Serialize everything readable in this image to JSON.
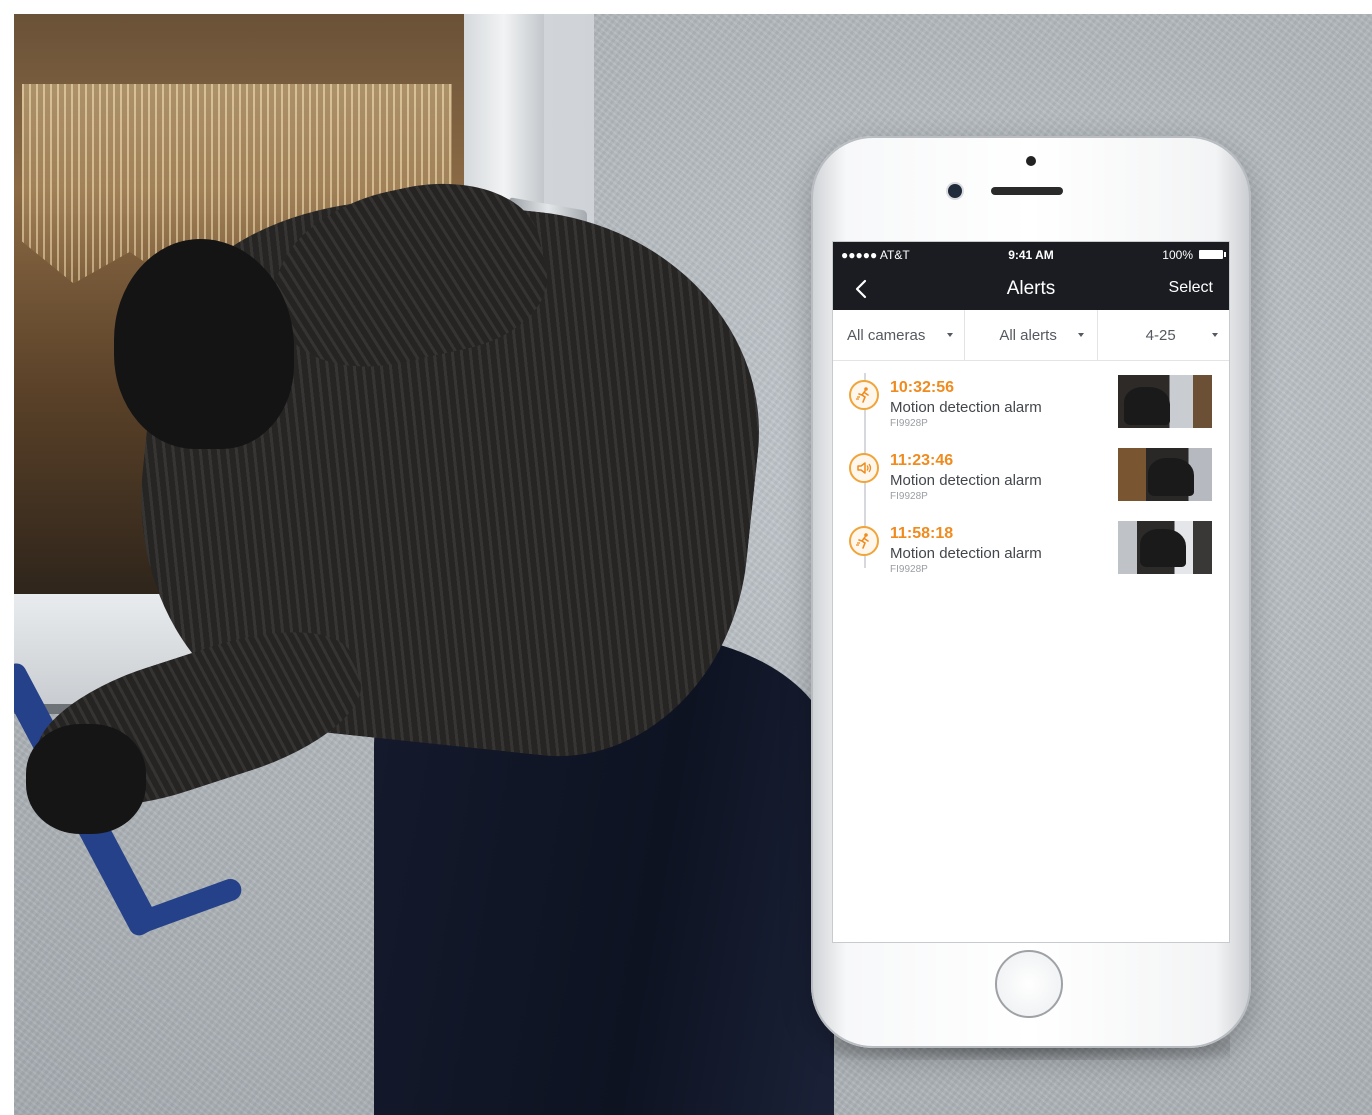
{
  "status_bar": {
    "carrier": "●●●●● AT&T",
    "time": "9:41 AM",
    "battery": "100%"
  },
  "nav": {
    "back_icon": "chevron-left-icon",
    "title": "Alerts",
    "select_label": "Select"
  },
  "filters": [
    {
      "label": "All cameras"
    },
    {
      "label": "All alerts"
    },
    {
      "label": "4-25"
    }
  ],
  "alerts": [
    {
      "time": "10:32:56",
      "type": "Motion detection alarm",
      "camera": "FI9928P",
      "icon": "running-person-icon"
    },
    {
      "time": "11:23:46",
      "type": "Motion detection alarm",
      "camera": "FI9928P",
      "icon": "speaker-icon"
    },
    {
      "time": "11:58:18",
      "type": "Motion detection alarm",
      "camera": "FI9928P",
      "icon": "running-person-icon"
    }
  ],
  "colors": {
    "accent": "#ef8b1f",
    "bar_bg": "#1b1c21"
  }
}
